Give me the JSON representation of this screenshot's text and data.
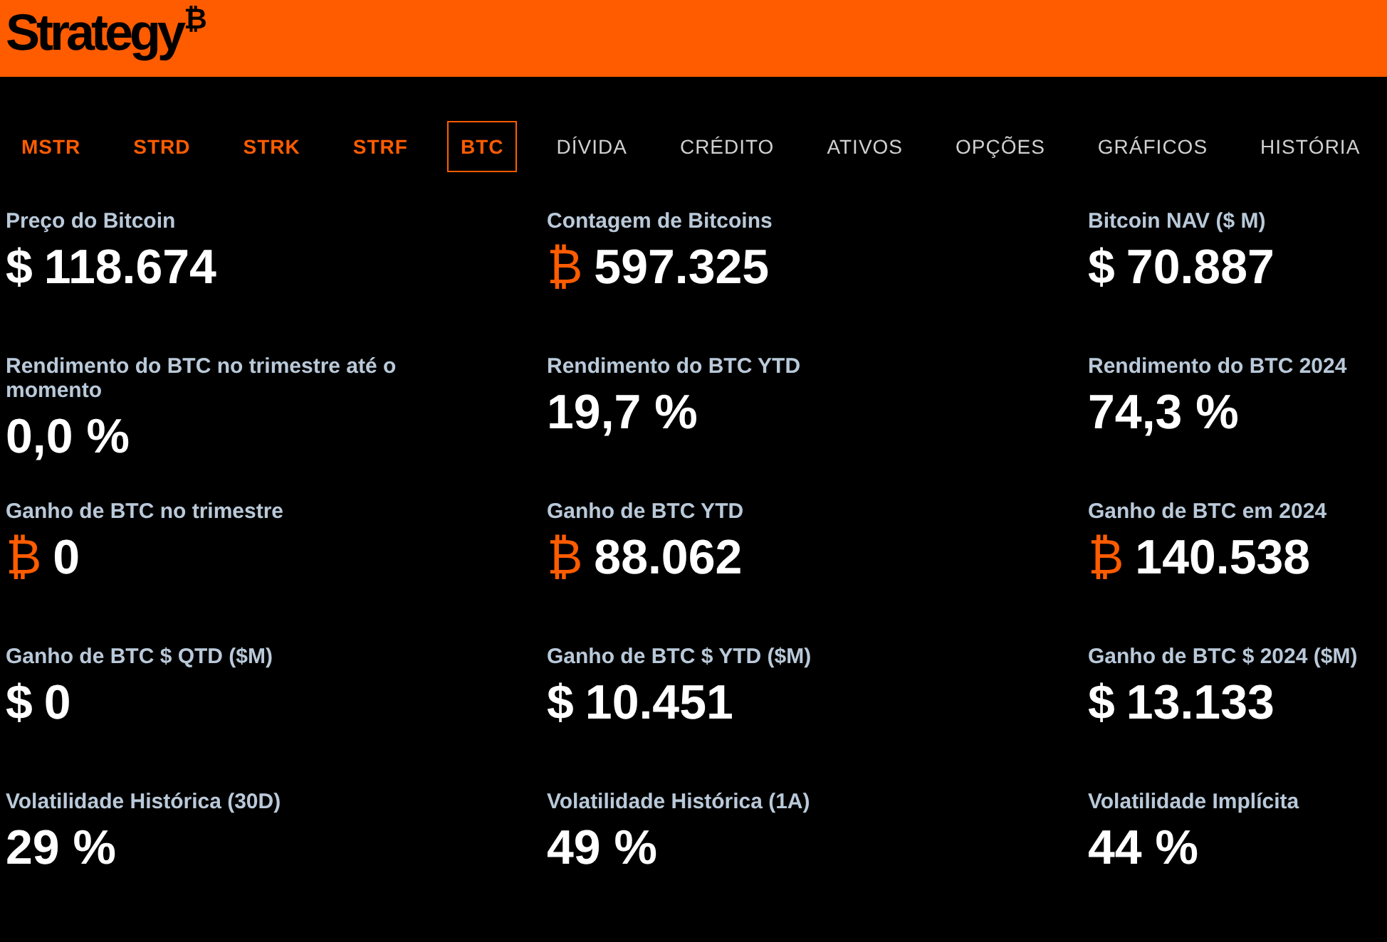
{
  "logo": {
    "name": "Strategy",
    "mark": "₿"
  },
  "tabs": [
    {
      "label": "MSTR",
      "kind": "ticker",
      "selected": false
    },
    {
      "label": "STRD",
      "kind": "ticker",
      "selected": false
    },
    {
      "label": "STRK",
      "kind": "ticker",
      "selected": false
    },
    {
      "label": "STRF",
      "kind": "ticker",
      "selected": false
    },
    {
      "label": "BTC",
      "kind": "ticker",
      "selected": true
    },
    {
      "label": "DÍVIDA",
      "kind": "section",
      "selected": false
    },
    {
      "label": "CRÉDITO",
      "kind": "section",
      "selected": false
    },
    {
      "label": "ATIVOS",
      "kind": "section",
      "selected": false
    },
    {
      "label": "OPÇÕES",
      "kind": "section",
      "selected": false
    },
    {
      "label": "GRÁFICOS",
      "kind": "section",
      "selected": false
    },
    {
      "label": "HISTÓRIA",
      "kind": "section",
      "selected": false
    }
  ],
  "metrics": [
    {
      "label": "Preço do Bitcoin",
      "kind": "fiat",
      "unit": "$",
      "value": "118.674"
    },
    {
      "label": "Contagem de Bitcoins",
      "kind": "bitcoin",
      "unit": "₿",
      "value": "597.325"
    },
    {
      "label": "Bitcoin NAV ($ M)",
      "kind": "fiat",
      "unit": "$",
      "value": "70.887"
    },
    {
      "label": "Rendimento do BTC no trimestre até o momento",
      "value": "0,0 %"
    },
    {
      "label": "Rendimento do BTC YTD",
      "value": "19,7 %"
    },
    {
      "label": "Rendimento do BTC 2024",
      "value": "74,3 %"
    },
    {
      "label": "Ganho de BTC no trimestre",
      "kind": "bitcoin",
      "unit": "₿",
      "value": "0"
    },
    {
      "label": "Ganho de BTC YTD",
      "kind": "bitcoin",
      "unit": "₿",
      "value": "88.062"
    },
    {
      "label": "Ganho de BTC em 2024",
      "kind": "bitcoin",
      "unit": "₿",
      "value": "140.538"
    },
    {
      "label": "Ganho de BTC $ QTD ($M)",
      "kind": "fiat",
      "unit": "$",
      "value": "0"
    },
    {
      "label": "Ganho de BTC $ YTD ($M)",
      "kind": "fiat",
      "unit": "$",
      "value": "10.451"
    },
    {
      "label": "Ganho de BTC $ 2024 ($M)",
      "kind": "fiat",
      "unit": "$",
      "value": "13.133"
    },
    {
      "label": "Volatilidade Histórica (30D)",
      "value": "29 %"
    },
    {
      "label": "Volatilidade Histórica (1A)",
      "value": "49 %"
    },
    {
      "label": "Volatilidade Implícita",
      "value": "44 %"
    }
  ]
}
